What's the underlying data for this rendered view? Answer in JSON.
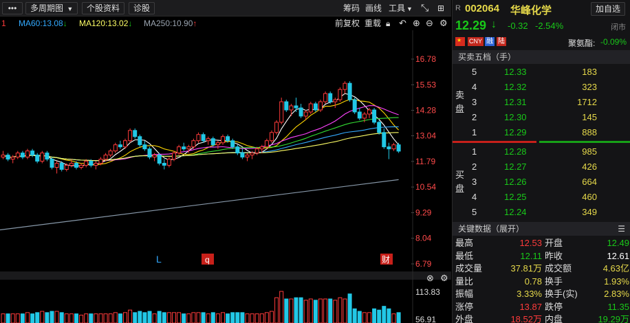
{
  "toolbar": {
    "menu_icon": "more-dots-icon",
    "period_label": "多周期图",
    "stock_info_label": "个股资料",
    "diagnose_label": "诊股",
    "chip_label": "筹码",
    "draw_label": "画线",
    "tools_label": "工具",
    "expand_icon": "expand-icon",
    "grid_icon": "grid-icon"
  },
  "ma_row": {
    "left_fragment": "1",
    "ma60": "MA60:13.08",
    "ma120": "MA120:13.02",
    "ma250": "MA250:10.90",
    "adj_label": "前复权",
    "redraw_label": "重载"
  },
  "colors": {
    "up": "#ff3b3b",
    "down": "#19c819",
    "ma5": "#ffffff",
    "ma10": "#ffd700",
    "ma20": "#ff44ff",
    "ma30": "#33dd33",
    "ma60": "#33aaff",
    "ma120": "#ffff66",
    "ma250": "#8899aa",
    "accent_text": "#e6d94a"
  },
  "price_axis": [
    "16.78",
    "15.53",
    "14.28",
    "13.04",
    "11.79",
    "10.54",
    "9.29",
    "8.04",
    "6.79"
  ],
  "volume_axis": [
    "113.83",
    "56.91"
  ],
  "markers": {
    "l": "L",
    "q": "q",
    "cai": "财"
  },
  "chart_data": {
    "type": "candlestick",
    "ylim": [
      6.79,
      16.78
    ],
    "ohlc": [
      [
        12.0,
        12.3,
        11.9,
        12.1
      ],
      [
        12.1,
        12.2,
        11.8,
        11.9
      ],
      [
        11.9,
        12.1,
        11.7,
        12.0
      ],
      [
        12.0,
        12.3,
        11.9,
        12.2
      ],
      [
        12.2,
        12.3,
        11.9,
        12.0
      ],
      [
        12.0,
        12.4,
        11.9,
        12.3
      ],
      [
        12.3,
        12.4,
        12.0,
        12.1
      ],
      [
        12.1,
        12.2,
        11.7,
        11.8
      ],
      [
        11.8,
        12.3,
        11.7,
        12.2
      ],
      [
        12.2,
        12.3,
        11.8,
        11.9
      ],
      [
        11.9,
        12.0,
        11.4,
        11.5
      ],
      [
        11.5,
        11.8,
        11.2,
        11.7
      ],
      [
        11.7,
        11.8,
        11.3,
        11.4
      ],
      [
        11.4,
        11.7,
        11.3,
        11.6
      ],
      [
        11.6,
        11.9,
        11.5,
        11.7
      ],
      [
        11.7,
        11.8,
        11.4,
        11.5
      ],
      [
        11.5,
        11.7,
        11.4,
        11.6
      ],
      [
        11.6,
        11.9,
        11.5,
        11.8
      ],
      [
        11.8,
        11.9,
        11.5,
        11.6
      ],
      [
        11.6,
        11.8,
        11.4,
        11.7
      ],
      [
        11.7,
        12.0,
        11.6,
        11.9
      ],
      [
        11.9,
        12.2,
        11.8,
        12.1
      ],
      [
        12.1,
        12.4,
        12.0,
        12.3
      ],
      [
        12.3,
        12.7,
        12.2,
        12.6
      ],
      [
        12.6,
        12.8,
        12.4,
        12.5
      ],
      [
        12.5,
        12.9,
        12.4,
        12.8
      ],
      [
        12.8,
        13.4,
        12.7,
        13.3
      ],
      [
        13.3,
        13.4,
        12.9,
        13.0
      ],
      [
        13.0,
        13.1,
        12.5,
        12.6
      ],
      [
        12.6,
        12.8,
        12.3,
        12.4
      ],
      [
        12.4,
        12.5,
        11.9,
        12.0
      ],
      [
        12.0,
        12.2,
        11.8,
        12.1
      ],
      [
        12.1,
        12.2,
        11.6,
        11.7
      ],
      [
        11.7,
        11.9,
        11.4,
        11.6
      ],
      [
        11.6,
        12.0,
        11.5,
        11.9
      ],
      [
        11.9,
        12.3,
        11.8,
        12.2
      ],
      [
        12.2,
        12.6,
        12.1,
        12.5
      ],
      [
        12.5,
        12.7,
        12.3,
        12.4
      ],
      [
        12.4,
        12.6,
        12.2,
        12.5
      ],
      [
        12.5,
        12.9,
        12.4,
        12.8
      ],
      [
        12.8,
        13.2,
        12.7,
        13.1
      ],
      [
        13.1,
        13.2,
        12.7,
        12.8
      ],
      [
        12.8,
        13.0,
        12.6,
        12.9
      ],
      [
        12.9,
        13.0,
        12.5,
        12.6
      ],
      [
        12.6,
        12.8,
        12.4,
        12.7
      ],
      [
        12.7,
        13.1,
        12.6,
        13.0
      ],
      [
        13.0,
        13.1,
        12.7,
        12.8
      ],
      [
        12.8,
        12.9,
        12.4,
        12.5
      ],
      [
        12.5,
        12.6,
        12.1,
        12.2
      ],
      [
        12.2,
        12.4,
        11.9,
        12.0
      ],
      [
        12.0,
        12.2,
        11.8,
        12.1
      ],
      [
        12.1,
        12.3,
        11.9,
        12.2
      ],
      [
        12.2,
        12.5,
        12.1,
        12.4
      ],
      [
        12.4,
        12.6,
        12.2,
        12.5
      ],
      [
        12.5,
        12.9,
        12.4,
        12.8
      ],
      [
        12.8,
        13.3,
        12.7,
        13.2
      ],
      [
        13.2,
        13.8,
        13.1,
        13.7
      ],
      [
        13.7,
        14.9,
        13.6,
        14.7
      ],
      [
        14.7,
        14.8,
        14.2,
        14.3
      ],
      [
        14.3,
        14.6,
        14.0,
        14.5
      ],
      [
        14.5,
        14.9,
        14.2,
        14.4
      ],
      [
        14.4,
        14.6,
        13.9,
        14.0
      ],
      [
        14.0,
        14.3,
        13.8,
        14.2
      ],
      [
        14.2,
        14.7,
        14.1,
        14.6
      ],
      [
        14.6,
        14.7,
        14.2,
        14.3
      ],
      [
        14.3,
        14.8,
        14.2,
        14.7
      ],
      [
        14.7,
        15.2,
        14.6,
        15.1
      ],
      [
        15.1,
        15.2,
        14.6,
        14.7
      ],
      [
        14.7,
        14.9,
        14.4,
        14.8
      ],
      [
        14.8,
        15.4,
        14.7,
        15.3
      ],
      [
        15.3,
        15.7,
        15.1,
        15.6
      ],
      [
        15.6,
        15.7,
        14.7,
        14.8
      ],
      [
        14.8,
        14.9,
        14.1,
        14.2
      ],
      [
        14.2,
        14.4,
        13.8,
        13.9
      ],
      [
        13.9,
        14.2,
        13.7,
        14.1
      ],
      [
        14.1,
        14.4,
        13.9,
        14.3
      ],
      [
        14.3,
        14.4,
        13.6,
        13.7
      ],
      [
        13.7,
        13.8,
        13.1,
        13.2
      ],
      [
        13.2,
        13.4,
        12.4,
        12.5
      ],
      [
        12.5,
        12.7,
        11.9,
        12.4
      ],
      [
        12.4,
        12.7,
        12.3,
        12.6
      ],
      [
        12.6,
        12.7,
        12.2,
        12.29
      ]
    ],
    "ma250_start": 8.45,
    "ma250_end": 10.9
  },
  "quote": {
    "prefix": "R",
    "code": "002064",
    "name": "华峰化学",
    "watch_label": "加自选",
    "price": "12.29",
    "arrow": "↓",
    "change": "-0.32",
    "change_pct": "-2.54%",
    "status": "闭市",
    "badges": [
      "CNY",
      "融",
      "陆"
    ],
    "index_label": "聚氨酯:",
    "index_change": "-0.09%"
  },
  "orderbook": {
    "title": "买卖五档（手）",
    "sell_label": [
      "卖",
      "盘"
    ],
    "buy_label": [
      "买",
      "盘"
    ],
    "sells": [
      {
        "level": "5",
        "price": "12.33",
        "vol": "183"
      },
      {
        "level": "4",
        "price": "12.32",
        "vol": "323"
      },
      {
        "level": "3",
        "price": "12.31",
        "vol": "1712"
      },
      {
        "level": "2",
        "price": "12.30",
        "vol": "145"
      },
      {
        "level": "1",
        "price": "12.29",
        "vol": "888"
      }
    ],
    "buys": [
      {
        "level": "1",
        "price": "12.28",
        "vol": "985"
      },
      {
        "level": "2",
        "price": "12.27",
        "vol": "426"
      },
      {
        "level": "3",
        "price": "12.26",
        "vol": "664"
      },
      {
        "level": "4",
        "price": "12.25",
        "vol": "460"
      },
      {
        "level": "5",
        "price": "12.24",
        "vol": "349"
      }
    ]
  },
  "key_data": {
    "title": "关键数据（展开）",
    "rows": [
      [
        {
          "k": "最高",
          "v": "12.53",
          "c": "up"
        },
        {
          "k": "开盘",
          "v": "12.49",
          "c": "dn"
        }
      ],
      [
        {
          "k": "最低",
          "v": "12.11",
          "c": "dn"
        },
        {
          "k": "昨收",
          "v": "12.61",
          "c": "wt"
        }
      ],
      [
        {
          "k": "成交量",
          "v": "37.81万",
          "c": "yl"
        },
        {
          "k": "成交额",
          "v": "4.63亿",
          "c": "yl"
        }
      ],
      [
        {
          "k": "量比",
          "v": "0.78",
          "c": "yl"
        },
        {
          "k": "换手",
          "v": "1.93%",
          "c": "yl"
        }
      ],
      [
        {
          "k": "振幅",
          "v": "3.33%",
          "c": "yl"
        },
        {
          "k": "换手(实)",
          "v": "2.83%",
          "c": "yl"
        }
      ],
      [
        {
          "k": "涨停",
          "v": "13.87",
          "c": "up"
        },
        {
          "k": "跌停",
          "v": "11.35",
          "c": "dn"
        }
      ],
      [
        {
          "k": "外盘",
          "v": "18.52万",
          "c": "up"
        },
        {
          "k": "内盘",
          "v": "19.29万",
          "c": "dn"
        }
      ]
    ]
  }
}
